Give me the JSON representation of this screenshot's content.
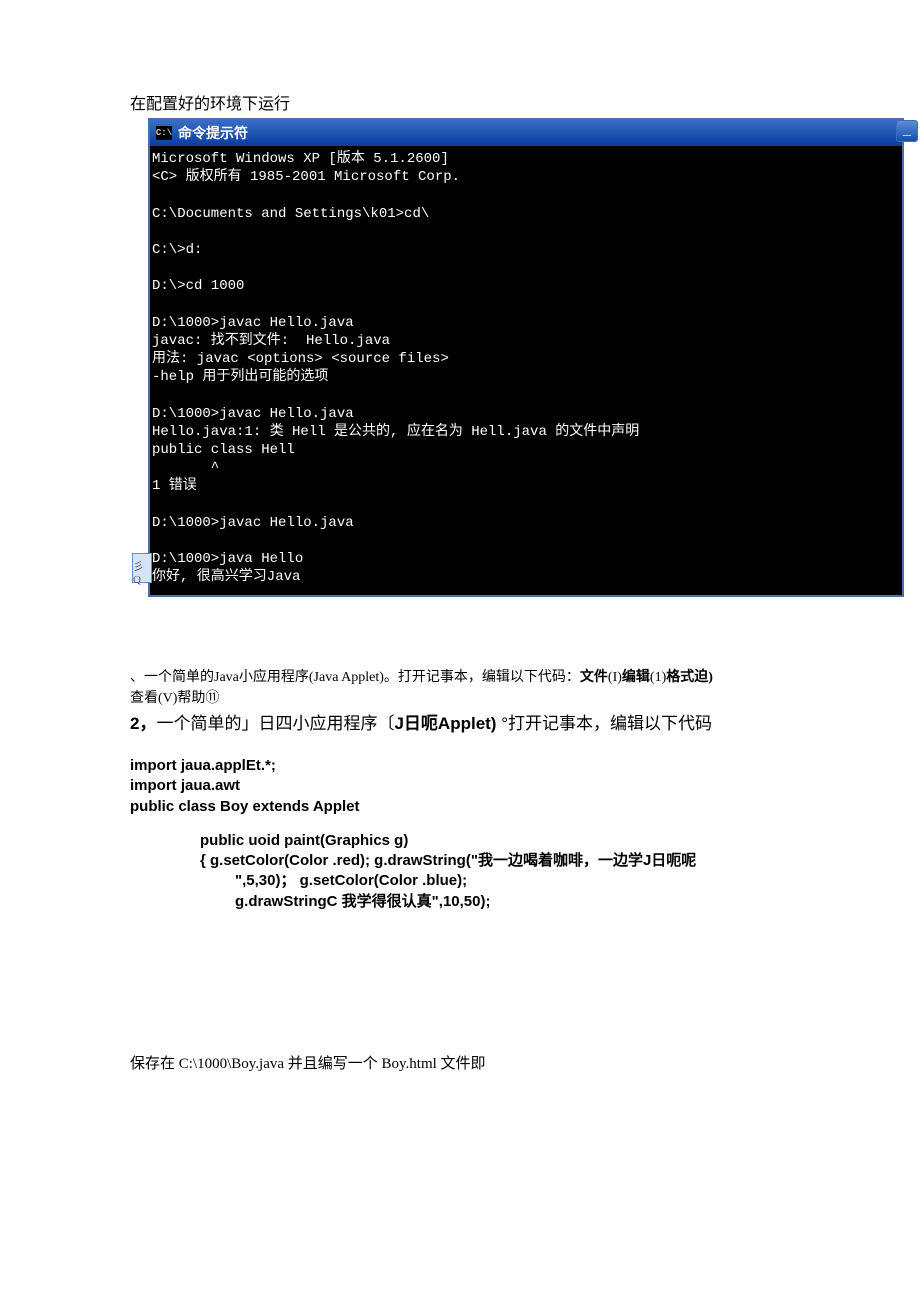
{
  "intro": "在配置好的环境下运行",
  "titlebar": {
    "icon_label": "C:\\",
    "title": "命令提示符"
  },
  "window_buttons": {
    "minimize": "_",
    "maximize": "□"
  },
  "terminal_lines": [
    "Microsoft Windows XP [版本 5.1.2600]",
    "<C> 版权所有 1985-2001 Microsoft Corp.",
    "",
    "C:\\Documents and Settings\\k01>cd\\",
    "",
    "C:\\>d:",
    "",
    "D:\\>cd 1000",
    "",
    "D:\\1000>javac Hello.java",
    "javac: 找不到文件:  Hello.java",
    "用法: javac <options> <source files>",
    "-help 用于列出可能的选项",
    "",
    "D:\\1000>javac Hello.java",
    "Hello.java:1: 类 Hell 是公共的, 应在名为 Hell.java 的文件中声明",
    "public class Hell",
    "       ^",
    "1 错误",
    "",
    "D:\\1000>javac Hello.java",
    "",
    "D:\\1000>java Hello",
    "你好, 很高兴学习Java"
  ],
  "side_marker": "彡Q",
  "para1": {
    "before_bold1": "、一个简单的Java小应用程序(Java Applet)。打开记事本，编辑以下代码：",
    "bold1": "文件",
    "after_bold1": "(I)",
    "bold2": "编辑",
    "after_bold2": "(1)",
    "bold3": "格式迫)",
    "line2": "查看(V)帮助⑪"
  },
  "para2": {
    "prefix": "2，",
    "body_before": "一个简单的」日四小应用程序〔",
    "bold": "J日呃Applet)",
    "body_after": " °打开记事本，编辑以下代码"
  },
  "code": {
    "l1": "import jaua.applEt.*;",
    "l2": "import jaua.awt",
    "l3": "public class Boy extends Applet",
    "l4": "public uoid paint(Graphics g)",
    "l5a": "{ g.setColor(Color .red); g.drawString(\"",
    "l5b": "我一边喝着咖啡，一边学J日呃呢",
    "l6": "\",5,30)；   g.setColor(Color .blue);",
    "l7a": "g.drawStringC ",
    "l7b": "我学得很认真\",10,50);"
  },
  "footer": "保存在 C:\\1000\\Boy.java 并且编写一个 Boy.html 文件即"
}
